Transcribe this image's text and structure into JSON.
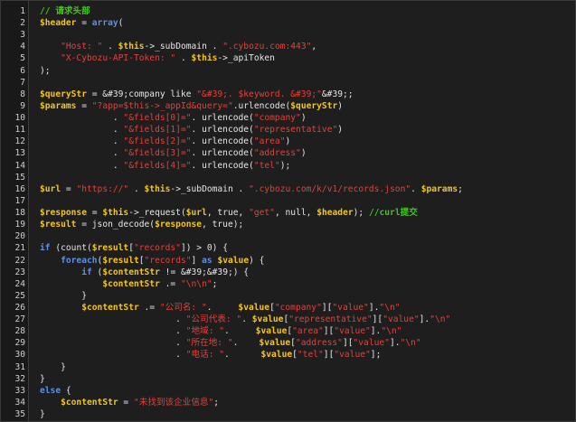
{
  "editor": {
    "lines": [
      {
        "n": "1",
        "tokens": [
          [
            "c",
            "// 请求头部"
          ]
        ]
      },
      {
        "n": "2",
        "tokens": [
          [
            "v",
            "$header"
          ],
          [
            "p",
            " = "
          ],
          [
            "k",
            "array"
          ],
          [
            "p",
            "("
          ]
        ]
      },
      {
        "n": "3",
        "tokens": []
      },
      {
        "n": "4",
        "tokens": [
          [
            "p",
            "    "
          ],
          [
            "s",
            "\"Host: \""
          ],
          [
            "p",
            " . "
          ],
          [
            "v",
            "$this"
          ],
          [
            "p",
            "->_subDomain . "
          ],
          [
            "s",
            "\".cybozu.com:443\""
          ],
          [
            "p",
            ","
          ]
        ]
      },
      {
        "n": "5",
        "tokens": [
          [
            "p",
            "    "
          ],
          [
            "s",
            "\"X-Cybozu-API-Token: \""
          ],
          [
            "p",
            " . "
          ],
          [
            "v",
            "$this"
          ],
          [
            "p",
            "->_apiToken"
          ]
        ]
      },
      {
        "n": "6",
        "tokens": [
          [
            "p",
            ");"
          ]
        ]
      },
      {
        "n": "7",
        "tokens": []
      },
      {
        "n": "8",
        "tokens": [
          [
            "v",
            "$queryStr"
          ],
          [
            "p",
            " = &#39;company like "
          ],
          [
            "s",
            "\"&#39;. $keyword. &#39;\""
          ],
          [
            "p",
            "&#39;;"
          ]
        ]
      },
      {
        "n": "9",
        "tokens": [
          [
            "v",
            "$params"
          ],
          [
            "p",
            " = "
          ],
          [
            "s",
            "\"?app=$this->_appId&query=\""
          ],
          [
            "p",
            ".urlencode("
          ],
          [
            "v",
            "$queryStr"
          ],
          [
            "p",
            ")"
          ]
        ]
      },
      {
        "n": "10",
        "tokens": [
          [
            "p",
            "              . "
          ],
          [
            "s",
            "\"&fields[0]=\""
          ],
          [
            "p",
            ". urlencode("
          ],
          [
            "s",
            "\"company\""
          ],
          [
            "p",
            ")"
          ]
        ]
      },
      {
        "n": "11",
        "tokens": [
          [
            "p",
            "              . "
          ],
          [
            "s",
            "\"&fields[1]=\""
          ],
          [
            "p",
            ". urlencode("
          ],
          [
            "s",
            "\"representative\""
          ],
          [
            "p",
            ")"
          ]
        ]
      },
      {
        "n": "12",
        "tokens": [
          [
            "p",
            "              . "
          ],
          [
            "s",
            "\"&fields[2]=\""
          ],
          [
            "p",
            ". urlencode("
          ],
          [
            "s",
            "\"area\""
          ],
          [
            "p",
            ")"
          ]
        ]
      },
      {
        "n": "13",
        "tokens": [
          [
            "p",
            "              . "
          ],
          [
            "s",
            "\"&fields[3]=\""
          ],
          [
            "p",
            ". urlencode("
          ],
          [
            "s",
            "\"address\""
          ],
          [
            "p",
            ")"
          ]
        ]
      },
      {
        "n": "14",
        "tokens": [
          [
            "p",
            "              . "
          ],
          [
            "s",
            "\"&fields[4]=\""
          ],
          [
            "p",
            ". urlencode("
          ],
          [
            "s",
            "\"tel\""
          ],
          [
            "p",
            ");"
          ]
        ]
      },
      {
        "n": "15",
        "tokens": []
      },
      {
        "n": "16",
        "tokens": [
          [
            "v",
            "$url"
          ],
          [
            "p",
            " = "
          ],
          [
            "s",
            "\"https://\""
          ],
          [
            "p",
            " . "
          ],
          [
            "v",
            "$this"
          ],
          [
            "p",
            "->_subDomain . "
          ],
          [
            "s",
            "\".cybozu.com/k/v1/records.json\""
          ],
          [
            "p",
            ". "
          ],
          [
            "v",
            "$params"
          ],
          [
            "p",
            ";"
          ]
        ]
      },
      {
        "n": "17",
        "tokens": []
      },
      {
        "n": "18",
        "tokens": [
          [
            "v",
            "$response"
          ],
          [
            "p",
            " = "
          ],
          [
            "v",
            "$this"
          ],
          [
            "p",
            "->_request("
          ],
          [
            "v",
            "$url"
          ],
          [
            "p",
            ", true, "
          ],
          [
            "s",
            "\"get\""
          ],
          [
            "p",
            ", null, "
          ],
          [
            "v",
            "$header"
          ],
          [
            "p",
            "); "
          ],
          [
            "c",
            "//curl提交"
          ]
        ]
      },
      {
        "n": "19",
        "tokens": [
          [
            "v",
            "$result"
          ],
          [
            "p",
            " = json_decode("
          ],
          [
            "v",
            "$response"
          ],
          [
            "p",
            ", true);"
          ]
        ]
      },
      {
        "n": "20",
        "tokens": []
      },
      {
        "n": "21",
        "tokens": [
          [
            "k",
            "if"
          ],
          [
            "p",
            " (count("
          ],
          [
            "v",
            "$result"
          ],
          [
            "p",
            "["
          ],
          [
            "s",
            "\"records\""
          ],
          [
            "p",
            "]) > 0) {"
          ]
        ]
      },
      {
        "n": "22",
        "tokens": [
          [
            "p",
            "    "
          ],
          [
            "k",
            "foreach"
          ],
          [
            "p",
            "("
          ],
          [
            "v",
            "$result"
          ],
          [
            "p",
            "["
          ],
          [
            "s",
            "\"records\""
          ],
          [
            "p",
            "] "
          ],
          [
            "k",
            "as"
          ],
          [
            "p",
            " "
          ],
          [
            "v",
            "$value"
          ],
          [
            "p",
            ") {"
          ]
        ]
      },
      {
        "n": "23",
        "tokens": [
          [
            "p",
            "        "
          ],
          [
            "k",
            "if"
          ],
          [
            "p",
            " ("
          ],
          [
            "v",
            "$contentStr"
          ],
          [
            "p",
            " != &#39;&#39;) {"
          ]
        ]
      },
      {
        "n": "24",
        "tokens": [
          [
            "p",
            "            "
          ],
          [
            "v",
            "$contentStr"
          ],
          [
            "p",
            " .= "
          ],
          [
            "s",
            "\"\\n\\n\""
          ],
          [
            "p",
            ";"
          ]
        ]
      },
      {
        "n": "25",
        "tokens": [
          [
            "p",
            "        }"
          ]
        ]
      },
      {
        "n": "26",
        "tokens": [
          [
            "p",
            "        "
          ],
          [
            "v",
            "$contentStr"
          ],
          [
            "p",
            " .= "
          ],
          [
            "s",
            "\"公司名: \""
          ],
          [
            "p",
            ".     "
          ],
          [
            "v",
            "$value"
          ],
          [
            "p",
            "["
          ],
          [
            "s",
            "\"company\""
          ],
          [
            "p",
            "]["
          ],
          [
            "s",
            "\"value\""
          ],
          [
            "p",
            "]."
          ],
          [
            "s",
            "\"\\n\""
          ]
        ]
      },
      {
        "n": "27",
        "tokens": [
          [
            "p",
            "                          . "
          ],
          [
            "s",
            "\"公司代表: \""
          ],
          [
            "p",
            ". "
          ],
          [
            "v",
            "$value"
          ],
          [
            "p",
            "["
          ],
          [
            "s",
            "\"representative\""
          ],
          [
            "p",
            "]["
          ],
          [
            "s",
            "\"value\""
          ],
          [
            "p",
            "]."
          ],
          [
            "s",
            "\"\\n\""
          ]
        ]
      },
      {
        "n": "28",
        "tokens": [
          [
            "p",
            "                          . "
          ],
          [
            "s",
            "\"地域: \""
          ],
          [
            "p",
            ".     "
          ],
          [
            "v",
            "$value"
          ],
          [
            "p",
            "["
          ],
          [
            "s",
            "\"area\""
          ],
          [
            "p",
            "]["
          ],
          [
            "s",
            "\"value\""
          ],
          [
            "p",
            "]."
          ],
          [
            "s",
            "\"\\n\""
          ]
        ]
      },
      {
        "n": "29",
        "tokens": [
          [
            "p",
            "                          . "
          ],
          [
            "s",
            "\"所在地: \""
          ],
          [
            "p",
            ".    "
          ],
          [
            "v",
            "$value"
          ],
          [
            "p",
            "["
          ],
          [
            "s",
            "\"address\""
          ],
          [
            "p",
            "]["
          ],
          [
            "s",
            "\"value\""
          ],
          [
            "p",
            "]."
          ],
          [
            "s",
            "\"\\n\""
          ]
        ]
      },
      {
        "n": "30",
        "tokens": [
          [
            "p",
            "                          . "
          ],
          [
            "s",
            "\"电话: \""
          ],
          [
            "p",
            ".      "
          ],
          [
            "v",
            "$value"
          ],
          [
            "p",
            "["
          ],
          [
            "s",
            "\"tel\""
          ],
          [
            "p",
            "]["
          ],
          [
            "s",
            "\"value\""
          ],
          [
            "p",
            "];"
          ]
        ]
      },
      {
        "n": "31",
        "tokens": [
          [
            "p",
            "    }"
          ]
        ]
      },
      {
        "n": "32",
        "tokens": [
          [
            "p",
            "}"
          ]
        ]
      },
      {
        "n": "33",
        "tokens": [
          [
            "k",
            "else"
          ],
          [
            "p",
            " {"
          ]
        ]
      },
      {
        "n": "34",
        "tokens": [
          [
            "p",
            "    "
          ],
          [
            "v",
            "$contentStr"
          ],
          [
            "p",
            " = "
          ],
          [
            "s",
            "\"未找到该企业信息\""
          ],
          [
            "p",
            ";"
          ]
        ]
      },
      {
        "n": "35",
        "tokens": [
          [
            "p",
            "}"
          ]
        ]
      }
    ]
  },
  "colors": {
    "background": "#1e1e1e",
    "variable": "#f5c518",
    "string": "#e5403a",
    "keyword": "#5f8fe6",
    "comment": "#43c41c",
    "plain": "#e6e6e6"
  }
}
